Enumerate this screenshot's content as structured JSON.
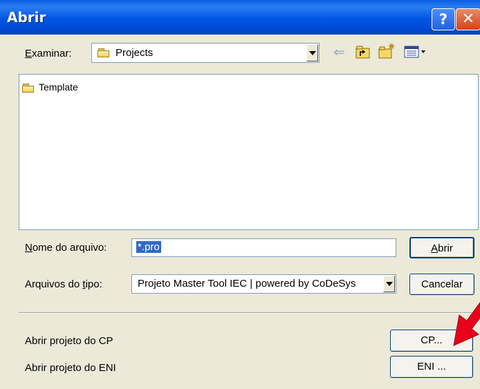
{
  "window": {
    "title": "Abrir"
  },
  "toolbar": {
    "lookin_label_mnemonic": "E",
    "lookin_label_rest": "xaminar:",
    "current_folder": "Projects",
    "icons": [
      "back-arrow-icon",
      "up-folder-icon",
      "new-folder-icon",
      "view-menu-icon"
    ]
  },
  "file_list": [
    {
      "name": "Template",
      "type": "folder"
    }
  ],
  "filename": {
    "label_mnemonic": "N",
    "label_rest": "ome do arquivo:",
    "value": "*.pro"
  },
  "filetype": {
    "label_prefix": "Arquivos do ",
    "label_mnemonic": "t",
    "label_suffix": "ipo:",
    "selected": "Projeto Master Tool IEC | powered by CoDeSys"
  },
  "buttons": {
    "open_mnemonic": "A",
    "open_rest": "brir",
    "cancel": "Cancelar",
    "cp": "CP...",
    "eni": "ENI ..."
  },
  "extra": {
    "open_cp_label": "Abrir projeto do CP",
    "open_eni_label": "Abrir projeto do ENI"
  },
  "colors": {
    "title_bar": "#0055E5",
    "accent_arrow": "#E8001C",
    "selection": "#316AC5"
  }
}
